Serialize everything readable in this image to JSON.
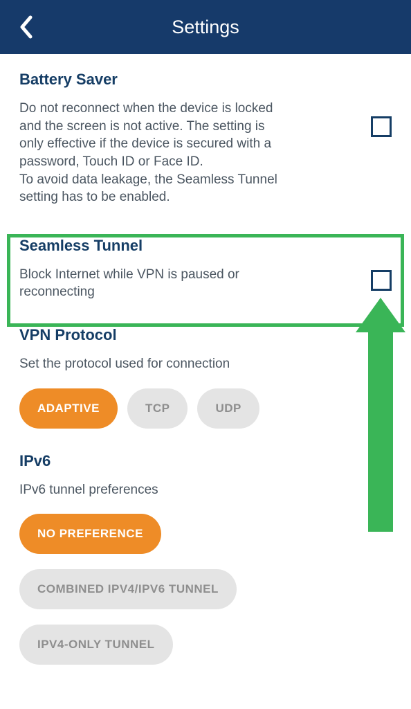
{
  "header": {
    "title": "Settings"
  },
  "battery_saver": {
    "title": "Battery Saver",
    "desc_line1": "Do not reconnect when the device is locked and the screen is not active. The setting is only effective if the device is secured with a password, Touch ID or Face ID.",
    "desc_line2": "To avoid data leakage, the Seamless Tunnel setting has to be enabled."
  },
  "seamless_tunnel": {
    "title": "Seamless Tunnel",
    "desc": "Block Internet while VPN is paused or reconnecting"
  },
  "vpn_protocol": {
    "title": "VPN Protocol",
    "desc": "Set the protocol used for connection",
    "options": {
      "adaptive": "ADAPTIVE",
      "tcp": "TCP",
      "udp": "UDP"
    }
  },
  "ipv6": {
    "title": "IPv6",
    "desc": "IPv6 tunnel preferences",
    "options": {
      "no_pref": "NO PREFERENCE",
      "combined": "COMBINED IPV4/IPV6 TUNNEL",
      "ipv4_only": "IPV4-ONLY TUNNEL"
    }
  }
}
